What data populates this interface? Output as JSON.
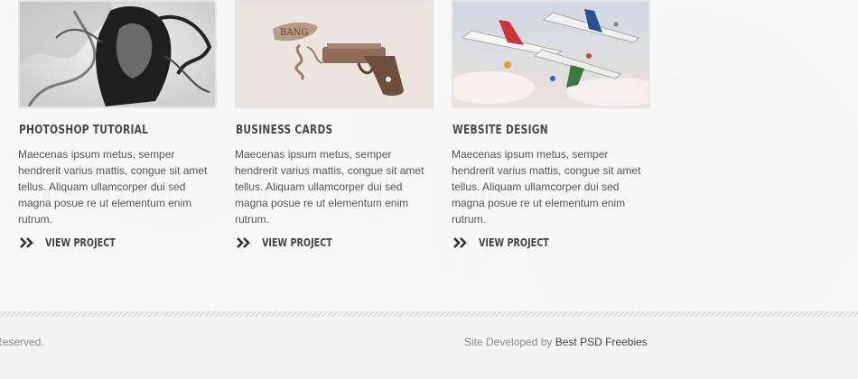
{
  "portfolio": {
    "items": [
      {
        "title": "PHOTOSHOP TUTORIAL",
        "description": "Maecenas ipsum metus, semper hendrerit varius mattis, congue sit amet tellus. Aliquam ullamcorper dui sed magna posue re ut elementum enim rutrum.",
        "link_label": "VIEW PROJECT",
        "thumb_icon": "smoke-portrait-image"
      },
      {
        "title": "BUSINESS CARDS",
        "description": "Maecenas ipsum metus, semper hendrerit varius mattis, congue sit amet tellus. Aliquam ullamcorper dui sed magna posue re ut elementum enim rutrum.",
        "link_label": "VIEW PROJECT",
        "thumb_icon": "pistol-bang-image",
        "thumb_text": "BANG"
      },
      {
        "title": "WEBSITE DESIGN",
        "description": "Maecenas ipsum metus, semper hendrerit varius mattis, congue sit amet tellus. Aliquam ullamcorper dui sed magna posue re ut elementum enim rutrum.",
        "link_label": "VIEW PROJECT",
        "thumb_icon": "airplanes-collage-image"
      }
    ]
  },
  "footer": {
    "copyright": "ghts Reserved.",
    "credit_prefix": "Site Developed by",
    "credit_link": "Best PSD Freebies"
  },
  "colors": {
    "heading": "#4a4a4a",
    "body_text": "#555555",
    "footer_text": "#8a8a8a"
  }
}
